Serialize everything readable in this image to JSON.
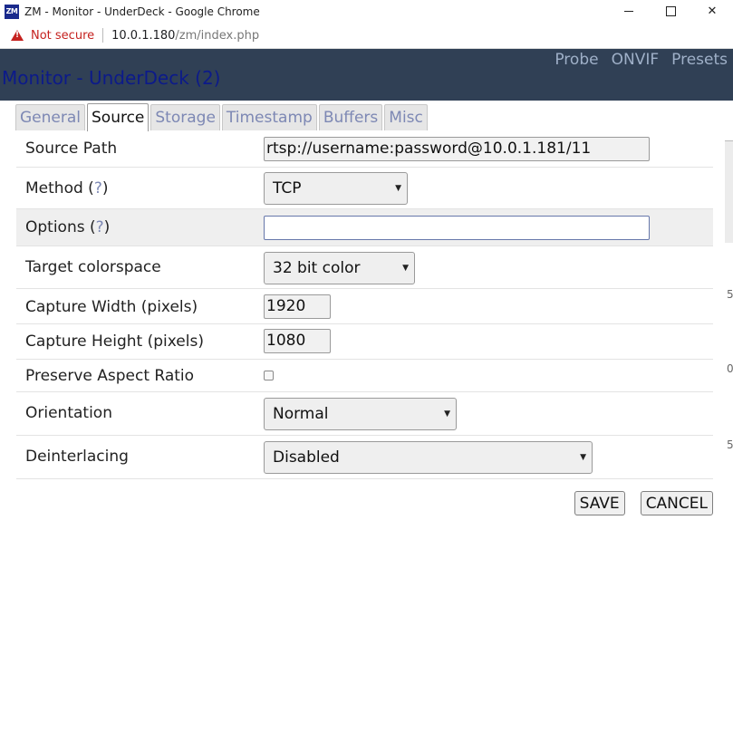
{
  "window": {
    "logo_text": "ZM",
    "title": "ZM - Monitor - UnderDeck - Google Chrome",
    "controls": {
      "close_glyph": "✕"
    }
  },
  "addressbar": {
    "security_label": "Not secure",
    "url_host": "10.0.1.180",
    "url_path": "/zm/index.php"
  },
  "header": {
    "title": "Monitor - UnderDeck (2)",
    "links": [
      "Probe",
      "ONVIF",
      "Presets"
    ]
  },
  "tabs": [
    "General",
    "Source",
    "Storage",
    "Timestamp",
    "Buffers",
    "Misc"
  ],
  "active_tab": "Source",
  "form": {
    "source_path": {
      "label": "Source Path",
      "value": "rtsp://username:password@10.0.1.181/11"
    },
    "method": {
      "label": "Method",
      "help": "?",
      "value": "TCP"
    },
    "options": {
      "label": "Options",
      "help": "?",
      "value": ""
    },
    "colorspace": {
      "label": "Target colorspace",
      "value": "32 bit color"
    },
    "capture_width": {
      "label": "Capture Width (pixels)",
      "value": "1920"
    },
    "capture_height": {
      "label": "Capture Height (pixels)",
      "value": "1080"
    },
    "preserve_aspect": {
      "label": "Preserve Aspect Ratio",
      "checked": false
    },
    "orientation": {
      "label": "Orientation",
      "value": "Normal"
    },
    "deinterlacing": {
      "label": "Deinterlacing",
      "value": "Disabled"
    }
  },
  "buttons": {
    "save": "SAVE",
    "cancel": "CANCEL"
  },
  "background_fragments": [
    "5",
    "0",
    "5"
  ],
  "colors": {
    "header_bg": "#304055",
    "title_text": "#0c1a8a",
    "link_text": "#9fb0c8",
    "warning": "#c5221f"
  }
}
